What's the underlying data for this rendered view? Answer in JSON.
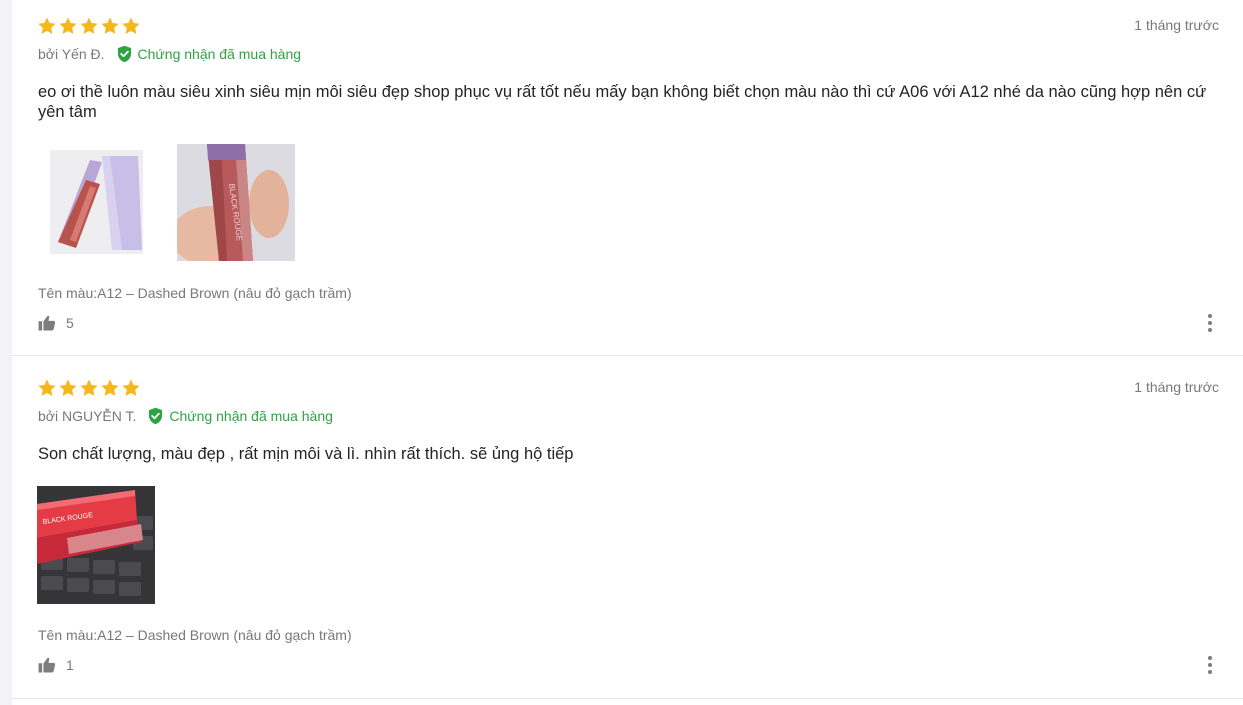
{
  "colors": {
    "star": "#f5b81b",
    "verified": "#2fa344",
    "muted": "#787878"
  },
  "reviews": [
    {
      "rating": 5,
      "time": "1 tháng trước",
      "author": "bởi Yến Đ.",
      "verified_label": "Chứng nhận đã mua hàng",
      "content": "eo ơi thề luôn màu siêu xinh siêu mịn môi siêu đẹp shop phục vụ rất tốt nếu mấy bạn không biết chọn màu nào thì cứ A06 với A12 nhé da nào cũng hợp nên cứ yên tâm",
      "photos": [
        "review-photo-lipstick-box",
        "review-photo-lipstick-hand"
      ],
      "variant": "Tên màu:A12 – Dashed Brown (nâu đỏ gạch trầm)",
      "likes": "5"
    },
    {
      "rating": 5,
      "time": "1 tháng trước",
      "author": "bởi NGUYỄN T.",
      "verified_label": "Chứng nhận đã mua hàng",
      "content": "Son chất lượng, màu đẹp , rất mịn môi và lì. nhìn rất thích. sẽ ủng hộ tiếp",
      "photos": [
        "review-photo-lipstick-keyboard"
      ],
      "variant": "Tên màu:A12 – Dashed Brown (nâu đỏ gạch trầm)",
      "likes": "1"
    }
  ]
}
